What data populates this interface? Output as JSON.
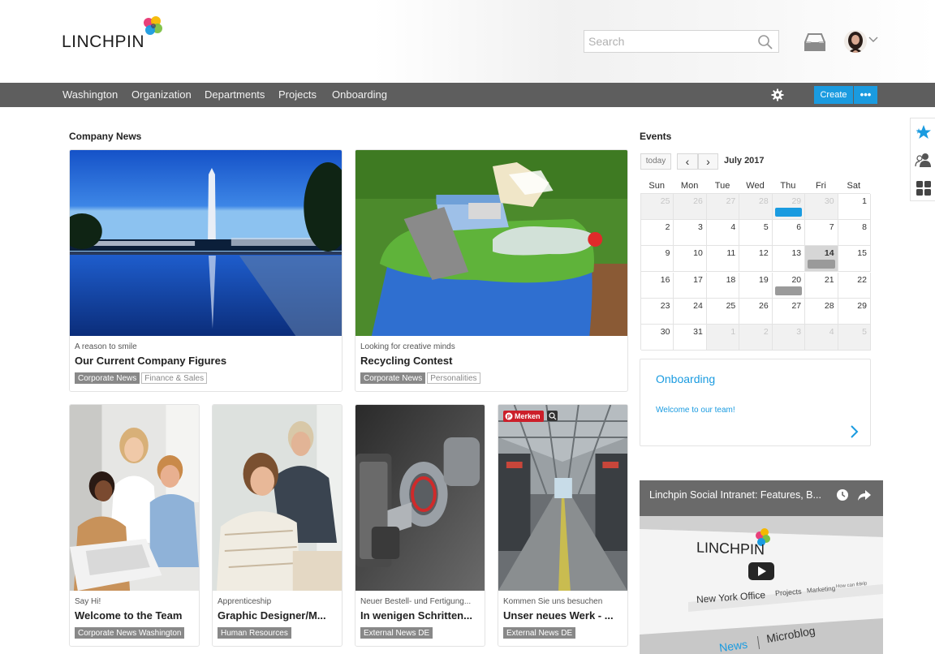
{
  "header": {
    "logo_text": "LINCHPIN",
    "search_placeholder": "Search"
  },
  "nav": {
    "items": [
      {
        "label": "Washington"
      },
      {
        "label": "Organization"
      },
      {
        "label": "Departments"
      },
      {
        "label": "Projects"
      },
      {
        "label": "Onboarding"
      }
    ],
    "create_label": "Create",
    "more_label": "•••"
  },
  "colors": {
    "accent": "#1a9be0",
    "nav_bg": "#5e5e5e",
    "tag_filled": "#888888"
  },
  "side_tools": {
    "icons": [
      "star-icon",
      "user-add-icon",
      "grid-icon"
    ]
  },
  "company_news": {
    "title": "Company News",
    "cards": [
      {
        "subtitle": "A reason to smile",
        "title": "Our Current Company Figures",
        "tags": [
          {
            "label": "Corporate News",
            "style": "filled"
          },
          {
            "label": "Finance & Sales",
            "style": "outline"
          }
        ]
      },
      {
        "subtitle": "Looking for creative minds",
        "title": "Recycling Contest",
        "tags": [
          {
            "label": "Corporate News",
            "style": "filled"
          },
          {
            "label": "Personalities",
            "style": "outline"
          }
        ]
      },
      {
        "subtitle": "Say Hi!",
        "title": "Welcome to the Team",
        "tags": [
          {
            "label": "Corporate News Washington",
            "style": "filled"
          }
        ]
      },
      {
        "subtitle": "Apprenticeship",
        "title": "Graphic Designer/M...",
        "tags": [
          {
            "label": "Human Resources",
            "style": "filled"
          }
        ]
      },
      {
        "subtitle": "Neuer Bestell- und Fertigung...",
        "title": "In wenigen Schritten...",
        "tags": [
          {
            "label": "External News DE",
            "style": "filled"
          }
        ]
      },
      {
        "subtitle": "Kommen Sie uns besuchen",
        "title": "Unser neues Werk - ...",
        "tags": [
          {
            "label": "External News DE",
            "style": "filled"
          }
        ]
      }
    ],
    "pin_badge": "Merken"
  },
  "events": {
    "title": "Events",
    "today_label": "today",
    "prev_label": "‹",
    "next_label": "›",
    "month_label": "July 2017",
    "weekdays": [
      "Sun",
      "Mon",
      "Tue",
      "Wed",
      "Thu",
      "Fri",
      "Sat"
    ],
    "weeks": [
      [
        "25",
        "26",
        "27",
        "28",
        "29",
        "30",
        "1"
      ],
      [
        "2",
        "3",
        "4",
        "5",
        "6",
        "7",
        "8"
      ],
      [
        "9",
        "10",
        "11",
        "12",
        "13",
        "14",
        "15"
      ],
      [
        "16",
        "17",
        "18",
        "19",
        "20",
        "21",
        "22"
      ],
      [
        "23",
        "24",
        "25",
        "26",
        "27",
        "28",
        "29"
      ],
      [
        "30",
        "31",
        "1",
        "2",
        "3",
        "4",
        "5"
      ]
    ],
    "other_month_days": [
      [
        0,
        0
      ],
      [
        0,
        1
      ],
      [
        0,
        2
      ],
      [
        0,
        3
      ],
      [
        0,
        4
      ],
      [
        0,
        5
      ],
      [
        5,
        2
      ],
      [
        5,
        3
      ],
      [
        5,
        4
      ],
      [
        5,
        5
      ],
      [
        5,
        6
      ]
    ],
    "today_day": "14",
    "event_markers": [
      {
        "week": 0,
        "day": 4,
        "color": "#1a9be0"
      },
      {
        "week": 2,
        "day": 5,
        "color": "#9a9a9a"
      },
      {
        "week": 3,
        "day": 4,
        "color": "#9a9a9a"
      }
    ]
  },
  "onboarding": {
    "title": "Onboarding",
    "text": "Welcome to our team!"
  },
  "video": {
    "title": "Linchpin Social Intranet: Features, B...",
    "logo_text": "LINCHPIN",
    "office_label": "New York Office",
    "projects_label": "Projects",
    "marketing_label": "Marketing",
    "howdo_label": "How can I...",
    "help_label": "Help",
    "news_label": "News",
    "microblog_label": "Microblog"
  }
}
